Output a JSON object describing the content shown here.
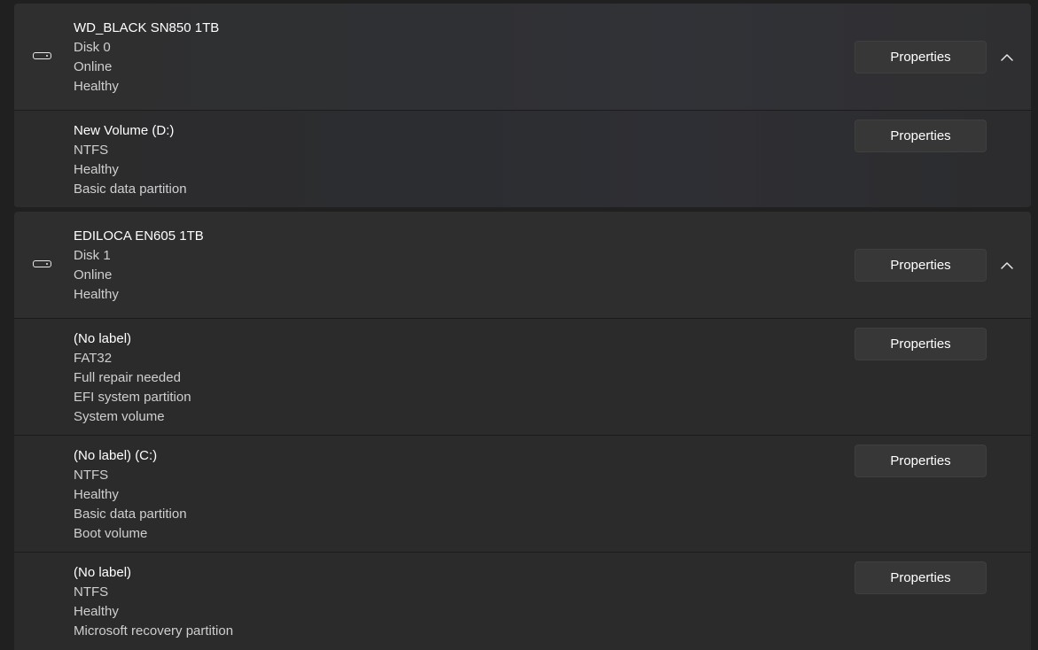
{
  "disks": [
    {
      "name": "WD_BLACK SN850 1TB",
      "details": [
        "Disk 0",
        "Online",
        "Healthy"
      ],
      "properties_label": "Properties",
      "icon": "drive-icon",
      "expand_icon": "chevron-up-icon",
      "volumes": [
        {
          "name": "New Volume (D:)",
          "details": [
            "NTFS",
            "Healthy",
            "Basic data partition"
          ],
          "properties_label": "Properties"
        }
      ]
    },
    {
      "name": "EDILOCA EN605 1TB",
      "details": [
        "Disk 1",
        "Online",
        "Healthy"
      ],
      "properties_label": "Properties",
      "icon": "drive-icon",
      "expand_icon": "chevron-up-icon",
      "volumes": [
        {
          "name": "(No label)",
          "details": [
            "FAT32",
            "Full repair needed",
            "EFI system partition",
            "System volume"
          ],
          "properties_label": "Properties"
        },
        {
          "name": "(No label) (C:)",
          "details": [
            "NTFS",
            "Healthy",
            "Basic data partition",
            "Boot volume"
          ],
          "properties_label": "Properties"
        },
        {
          "name": "(No label)",
          "details": [
            "NTFS",
            "Healthy",
            "Microsoft recovery partition"
          ],
          "properties_label": "Properties"
        }
      ]
    }
  ]
}
